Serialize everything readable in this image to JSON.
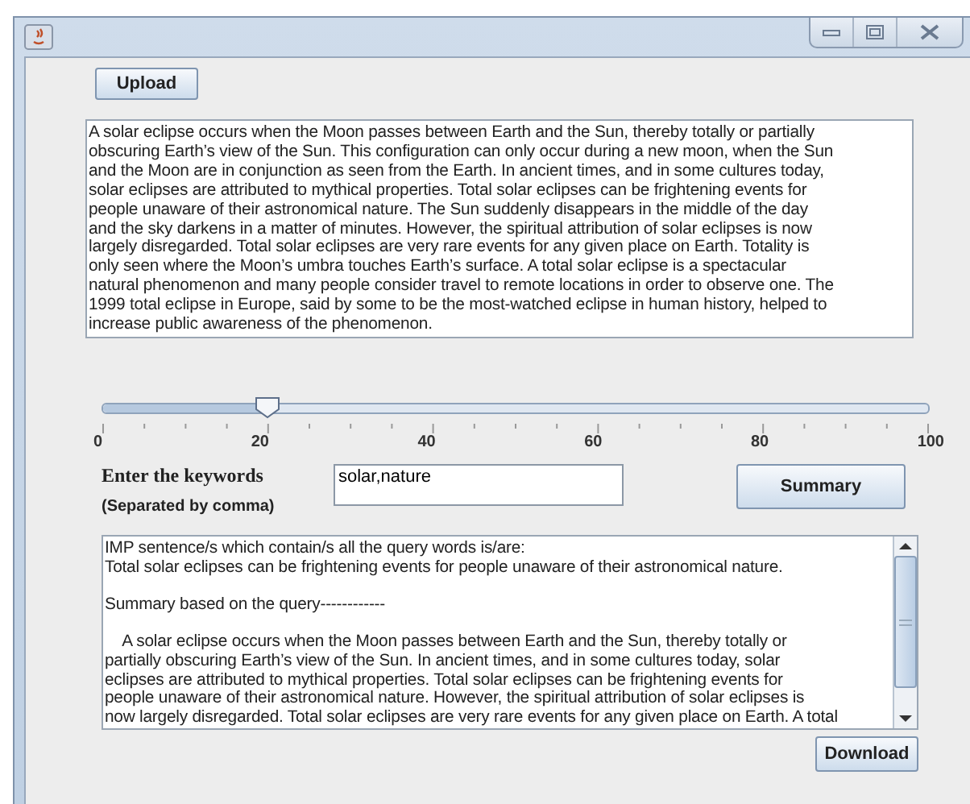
{
  "upload_button": "Upload",
  "document_lines": [
    "A solar eclipse occurs when the Moon passes between Earth and the Sun, thereby totally or partially",
    "obscuring Earth’s view of the Sun. This configuration can only occur during a new moon, when the Sun",
    "and the Moon are in conjunction as seen from the Earth. In ancient times, and in some cultures today,",
    "solar eclipses are attributed to mythical properties. Total solar eclipses can be frightening events for",
    "people unaware of their astronomical nature. The Sun suddenly disappears in the middle of the day",
    "and the sky darkens in a matter of minutes. However, the spiritual attribution of solar eclipses is now",
    "largely disregarded. Total solar eclipses are very rare events for any given place on Earth. Totality is",
    "only seen where the Moon’s umbra touches Earth’s surface. A total solar eclipse is a spectacular",
    "natural phenomenon and many people consider travel to remote locations in order to observe one. The",
    "1999 total eclipse in Europe, said by some to be the most-watched eclipse in human history, helped to",
    "increase public awareness of the phenomenon."
  ],
  "slider": {
    "level": 0.2,
    "labels": [
      "0",
      "20",
      "40",
      "60",
      "80",
      "100"
    ]
  },
  "keywords": {
    "label": "Enter the keywords",
    "hint": "(Separated by comma)",
    "value": "solar,nature"
  },
  "summary_button": "Summary",
  "output_blocks": [
    {
      "lines": [
        "IMP sentence/s which contain/s all the query words is/are:",
        "Total solar eclipses can be frightening events for people unaware of their astronomical nature."
      ]
    },
    {
      "lines": [
        "Summary based on the query------------"
      ]
    },
    {
      "lines": [
        "    A solar eclipse occurs when the Moon passes between Earth and the Sun, thereby totally or",
        "partially obscuring Earth’s view of the Sun. In ancient times, and in some cultures today, solar",
        "eclipses are attributed to mythical properties. Total solar eclipses can be frightening events for",
        "people unaware of their astronomical nature. However, the spiritual attribution of solar eclipses is",
        "now largely disregarded. Total solar eclipses are very rare events for any given place on Earth. A total"
      ]
    }
  ],
  "download_button": "Download"
}
